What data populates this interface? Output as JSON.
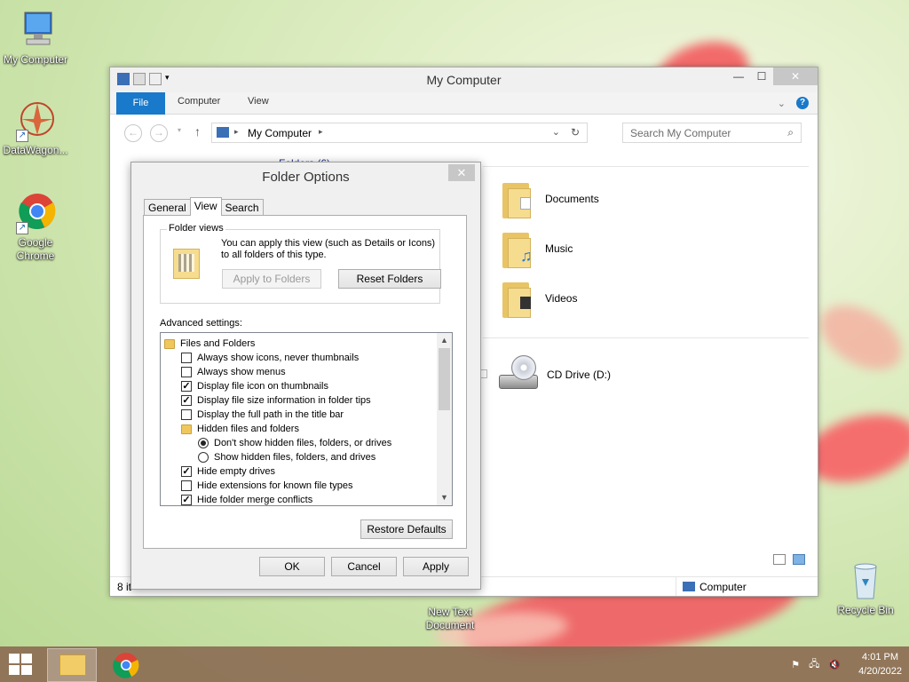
{
  "desktop": {
    "icons": [
      {
        "label": "My Computer"
      },
      {
        "label": "DataWagon..."
      },
      {
        "label": "Google Chrome"
      },
      {
        "label": "New Text Document"
      },
      {
        "label": "Recycle Bin"
      }
    ]
  },
  "explorer": {
    "title": "My Computer",
    "ribbon_tabs": [
      "File",
      "Computer",
      "View"
    ],
    "address": "My Computer",
    "search_placeholder": "Search My Computer",
    "header_fragment": "Folders (6)",
    "items": [
      {
        "label": "Documents",
        "icon": "documents-folder-icon"
      },
      {
        "label": "Music",
        "icon": "music-folder-icon"
      },
      {
        "label": "Videos",
        "icon": "videos-folder-icon"
      },
      {
        "label": "CD Drive (D:)",
        "icon": "cd-drive-icon"
      }
    ],
    "status_left": "8 it",
    "status_right": "Computer"
  },
  "dialog": {
    "title": "Folder Options",
    "tabs": [
      "General",
      "View",
      "Search"
    ],
    "active_tab": "View",
    "folder_views_label": "Folder views",
    "folder_views_text": "You can apply this view (such as Details or Icons) to all folders of this type.",
    "apply_to_folders": "Apply to Folders",
    "reset_folders": "Reset Folders",
    "advanced_label": "Advanced settings:",
    "tree": [
      {
        "type": "folder",
        "label": "Files and Folders",
        "indent": 0
      },
      {
        "type": "checkbox",
        "label": "Always show icons, never thumbnails",
        "checked": false,
        "indent": 1
      },
      {
        "type": "checkbox",
        "label": "Always show menus",
        "checked": false,
        "indent": 1
      },
      {
        "type": "checkbox",
        "label": "Display file icon on thumbnails",
        "checked": true,
        "indent": 1
      },
      {
        "type": "checkbox",
        "label": "Display file size information in folder tips",
        "checked": true,
        "indent": 1
      },
      {
        "type": "checkbox",
        "label": "Display the full path in the title bar",
        "checked": false,
        "indent": 1
      },
      {
        "type": "folder",
        "label": "Hidden files and folders",
        "indent": 1
      },
      {
        "type": "radio",
        "label": "Don't show hidden files, folders, or drives",
        "checked": true,
        "indent": 2
      },
      {
        "type": "radio",
        "label": "Show hidden files, folders, and drives",
        "checked": false,
        "indent": 2
      },
      {
        "type": "checkbox",
        "label": "Hide empty drives",
        "checked": true,
        "indent": 1
      },
      {
        "type": "checkbox",
        "label": "Hide extensions for known file types",
        "checked": false,
        "indent": 1
      },
      {
        "type": "checkbox",
        "label": "Hide folder merge conflicts",
        "checked": true,
        "indent": 1
      }
    ],
    "restore_defaults": "Restore Defaults",
    "ok": "OK",
    "cancel": "Cancel",
    "apply": "Apply"
  },
  "taskbar": {
    "time": "4:01 PM",
    "date": "4/20/2022"
  },
  "colors": {
    "accent": "#1979ca",
    "taskbar": "#8c6c54"
  }
}
